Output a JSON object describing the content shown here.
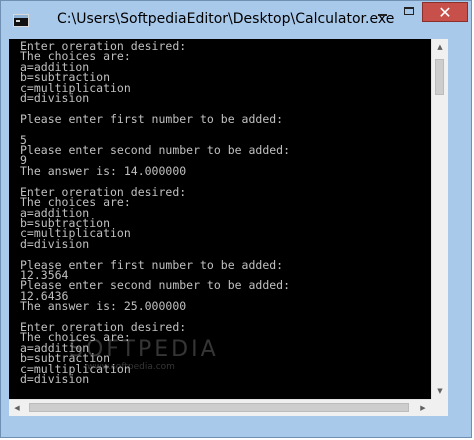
{
  "window": {
    "title": "C:\\Users\\SoftpediaEditor\\Desktop\\Calculator.exe",
    "icon": "console-app-icon"
  },
  "controls": {
    "minimize": "minimize-icon",
    "maximize": "maximize-icon",
    "close_glyph": "✕"
  },
  "console": {
    "lines": [
      "Enter oreration desired:",
      "The choices are:",
      "a=addition",
      "b=subtraction",
      "c=multiplication",
      "d=division",
      "",
      "Please enter first number to be added:",
      "",
      "5",
      "Please enter second number to be added:",
      "9",
      "The answer is: 14.000000",
      "",
      "Enter oreration desired:",
      "The choices are:",
      "a=addition",
      "b=subtraction",
      "c=multiplication",
      "d=division",
      "",
      "Please enter first number to be added:",
      "12.3564",
      "Please enter second number to be added:",
      "12.6436",
      "The answer is: 25.000000",
      "",
      "Enter oreration desired:",
      "The choices are:",
      "a=addition",
      "b=subtraction",
      "c=multiplication",
      "d=division"
    ],
    "text_color": "#c0c0c0",
    "background": "#000000"
  },
  "watermark": {
    "brand": "SOFTPEDIA",
    "url": "www.softpedia.com"
  },
  "scrollbars": {
    "up_glyph": "▲",
    "down_glyph": "▼",
    "left_glyph": "◀",
    "right_glyph": "▶"
  }
}
